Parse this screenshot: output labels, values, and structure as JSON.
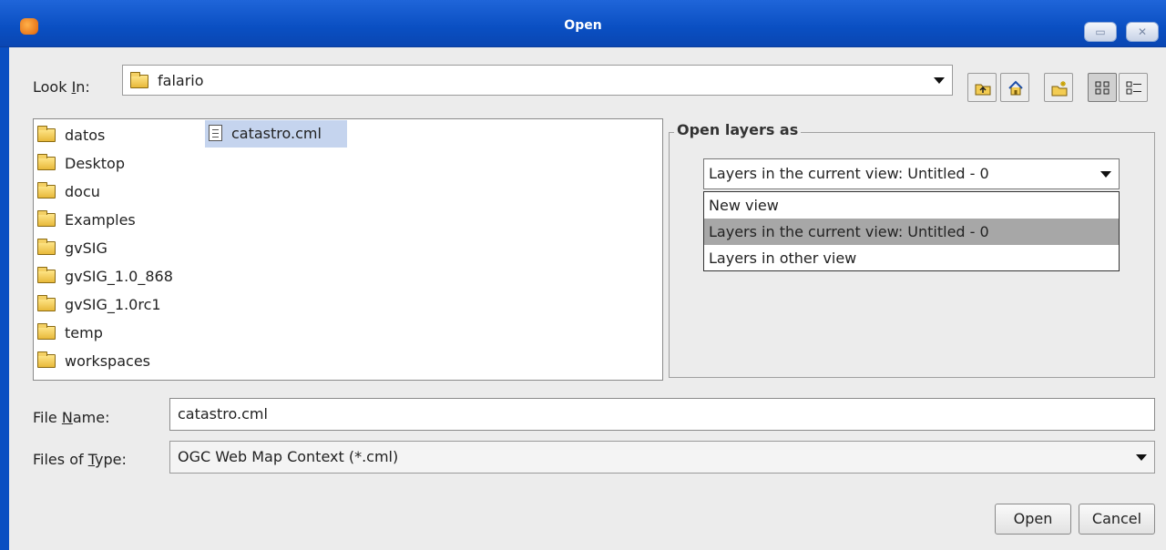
{
  "window": {
    "title": "Open"
  },
  "look_in": {
    "label_prefix": "Look ",
    "label_mnemonic": "I",
    "label_suffix": "n:",
    "value": "falario",
    "toolbar_icons": [
      "up-folder-icon",
      "home-icon",
      "new-folder-icon",
      "list-view-icon",
      "details-view-icon"
    ]
  },
  "files": [
    {
      "name": "datos",
      "type": "folder"
    },
    {
      "name": "Desktop",
      "type": "folder"
    },
    {
      "name": "docu",
      "type": "folder"
    },
    {
      "name": "Examples",
      "type": "folder"
    },
    {
      "name": "gvSIG",
      "type": "folder"
    },
    {
      "name": "gvSIG_1.0_868",
      "type": "folder"
    },
    {
      "name": "gvSIG_1.0rc1",
      "type": "folder"
    },
    {
      "name": "temp",
      "type": "folder"
    },
    {
      "name": "workspaces",
      "type": "folder"
    },
    {
      "name": "catastro.cml",
      "type": "file",
      "selected": true
    }
  ],
  "open_layers": {
    "title": "Open layers as",
    "selected": "Layers in the current view: Untitled - 0",
    "options": [
      "New view",
      "Layers in the current view: Untitled - 0",
      "Layers in other view"
    ],
    "highlighted_index": 1
  },
  "file_name": {
    "label_prefix": "File ",
    "label_mnemonic": "N",
    "label_suffix": "ame:",
    "value": "catastro.cml"
  },
  "files_of_type": {
    "label_prefix": "Files of ",
    "label_mnemonic": "T",
    "label_suffix": "ype:",
    "value": "OGC Web Map Context (*.cml)"
  },
  "buttons": {
    "open": "Open",
    "cancel": "Cancel"
  },
  "colors": {
    "titlebar": "#0a4fc2",
    "selection": "#c5d4ee",
    "dropdown_highlight": "#a7a7a7"
  }
}
